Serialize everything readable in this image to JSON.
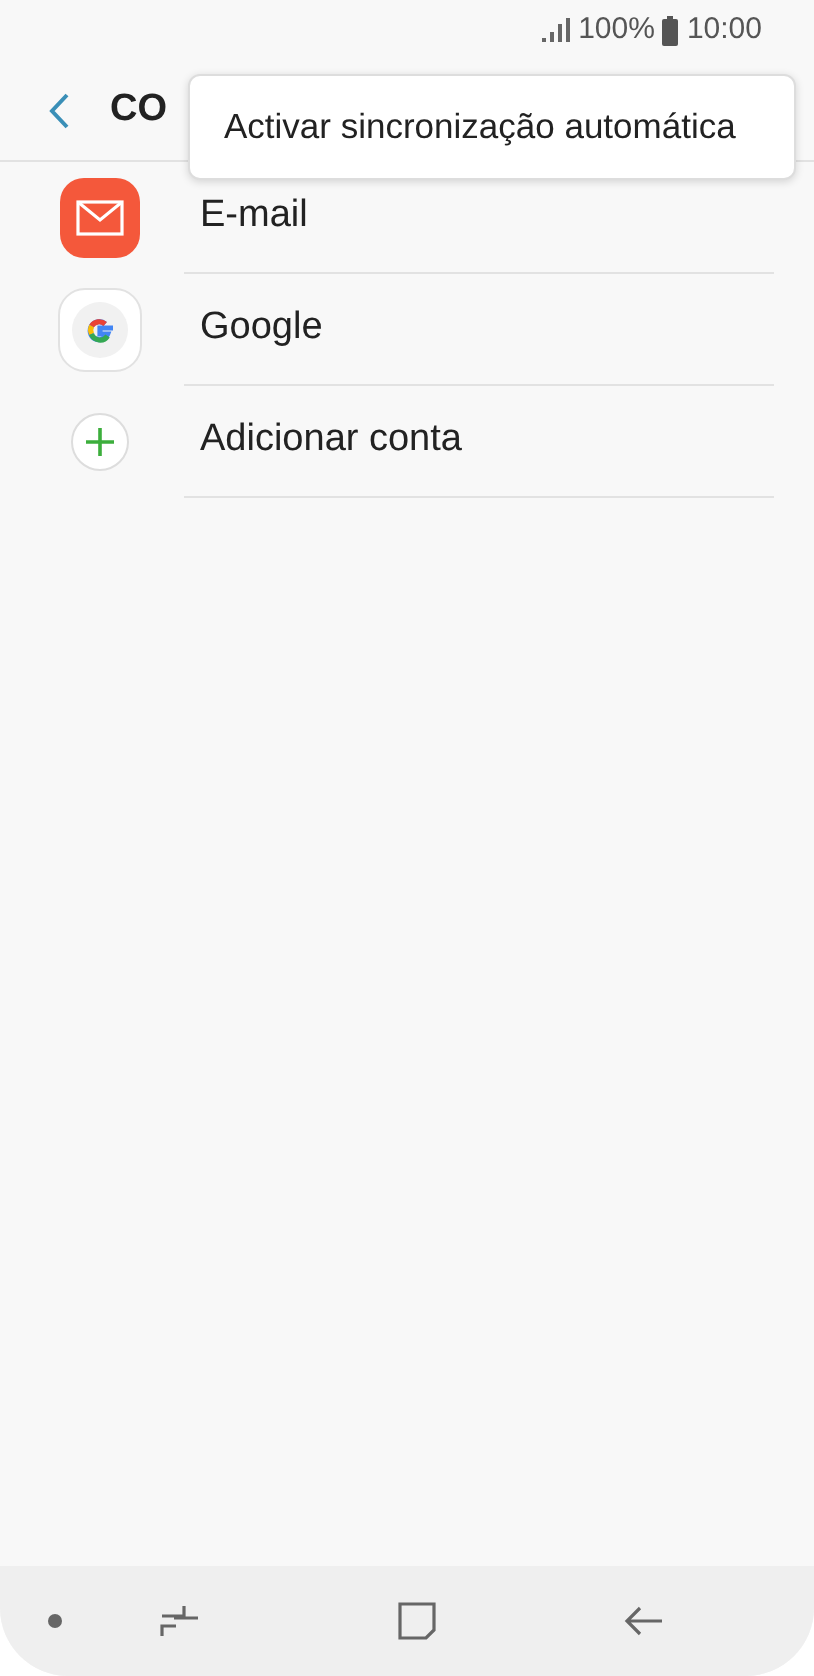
{
  "status_bar": {
    "battery": "100%",
    "time": "10:00"
  },
  "app_bar": {
    "title": "CO"
  },
  "menu": {
    "items": [
      "Activar sincronização automática"
    ]
  },
  "accounts": [
    {
      "kind": "email",
      "label": "E-mail"
    },
    {
      "kind": "google",
      "label": "Google"
    },
    {
      "kind": "add",
      "label": "Adicionar conta"
    }
  ]
}
